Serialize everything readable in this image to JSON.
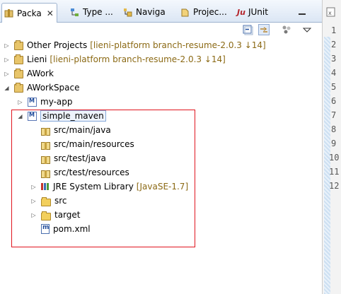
{
  "tabs": [
    {
      "label": "Packa",
      "icon": "package-explorer-icon",
      "closable": true
    },
    {
      "label": "Type ...",
      "icon": "type-hierarchy-icon"
    },
    {
      "label": "Naviga",
      "icon": "navigator-icon"
    },
    {
      "label": "Projec...",
      "icon": "project-explorer-icon"
    },
    {
      "label": "JUnit",
      "icon": "junit-icon",
      "icon_text": "Ju"
    }
  ],
  "toolbar": {
    "collapse_all": "collapse-all-icon",
    "link_editor": "link-with-editor-icon",
    "view_menu": "view-menu-icon"
  },
  "tree": {
    "other_projects": {
      "label": "Other Projects",
      "decoration": "[lieni-platform branch-resume-2.0.3 ↓14]"
    },
    "lieni": {
      "label": "Lieni",
      "decoration": "[lieni-platform branch-resume-2.0.3 ↓14]"
    },
    "awork": {
      "label": "AWork"
    },
    "aworkspace": {
      "label": "AWorkSpace"
    },
    "my_app": {
      "label": "my-app"
    },
    "simple_maven": {
      "label": "simple_maven"
    },
    "src_main_java": {
      "label": "src/main/java"
    },
    "src_main_resources": {
      "label": "src/main/resources"
    },
    "src_test_java": {
      "label": "src/test/java"
    },
    "src_test_resources": {
      "label": "src/test/resources"
    },
    "jre": {
      "label": "JRE System Library",
      "decoration": "[JavaSE-1.7]"
    },
    "src": {
      "label": "src"
    },
    "target": {
      "label": "target"
    },
    "pom": {
      "label": "pom.xml"
    }
  },
  "editor": {
    "line_numbers": [
      "1",
      "2",
      "3",
      "4",
      "5",
      "6",
      "7",
      "8",
      "9",
      "10",
      "11",
      "12"
    ]
  },
  "colors": {
    "highlight_box": "#e0141e",
    "decoration": "#8b6914",
    "tab_bar": "#dbe6f4"
  }
}
